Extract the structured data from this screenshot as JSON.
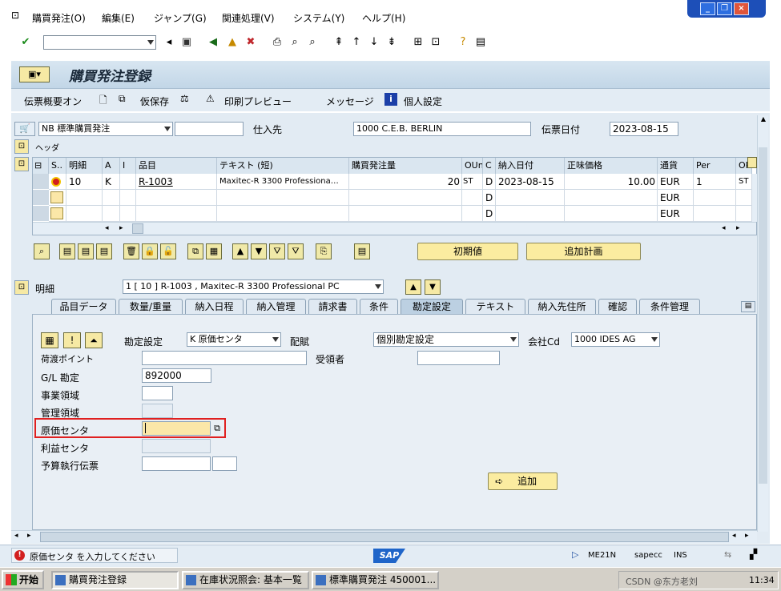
{
  "menu": [
    "購買発注(O)",
    "編集(E)",
    "ジャンプ(G)",
    "関連処理(V)",
    "システム(Y)",
    "ヘルプ(H)"
  ],
  "title": "購買発注登録",
  "app_toolbar": {
    "doc_overview": "伝票概要オン",
    "hold": "仮保存",
    "print_preview": "印刷プレビュー",
    "messages": "メッセージ",
    "personal_settings": "個人設定"
  },
  "header": {
    "doc_type": "NB 標準購買発注",
    "vendor_label": "仕入先",
    "vendor_value": "1000 C.E.B. BERLIN",
    "doc_date_label": "伝票日付",
    "doc_date_value": "2023-08-15",
    "header_label": "ヘッダ"
  },
  "table": {
    "columns": [
      "S..",
      "明細",
      "A",
      "I",
      "品目",
      "テキスト (短)",
      "購買発注量",
      "OUn",
      "C",
      "納入日付",
      "正味価格",
      "通貨",
      "Per",
      "OP"
    ],
    "rows": [
      {
        "item": "10",
        "a": "K",
        "material": "R-1003",
        "text": "Maxitec-R 3300 Professiona…",
        "qty": "20",
        "oun": "ST",
        "c": "D",
        "date": "2023-08-15",
        "price": "10.00",
        "curr": "EUR",
        "per": "1",
        "op": "ST"
      },
      {
        "c": "D",
        "curr": "EUR"
      },
      {
        "c": "D",
        "curr": "EUR"
      }
    ]
  },
  "buttons": {
    "default_values": "初期値",
    "add_planning": "追加計画",
    "add": "追加"
  },
  "detail": {
    "label": "明細",
    "selected": "1 [ 10 ] R-1003 , Maxitec-R 3300 Professional PC"
  },
  "tabs": [
    "品目データ",
    "数量/重量",
    "納入日程",
    "納入管理",
    "請求書",
    "条件",
    "勘定設定",
    "テキスト",
    "納入先住所",
    "確認",
    "条件管理"
  ],
  "active_tab": "勘定設定",
  "account": {
    "acc_label": "勘定設定",
    "acc_value": "K 原価センタ",
    "distribution_label": "配賦",
    "distribution_value": "個別勘定設定",
    "company_label": "会社Cd",
    "company_value": "1000 IDES AG",
    "unloading_label": "荷渡ポイント",
    "recipient_label": "受領者",
    "gl_label": "G/L 勘定",
    "gl_value": "892000",
    "business_area_label": "事業領域",
    "controlling_area_label": "管理領域",
    "cost_center_label": "原価センタ",
    "profit_center_label": "利益センタ",
    "funds_label": "予算執行伝票"
  },
  "status": {
    "message": "原価センタ を入力してください",
    "brand": "SAP",
    "tcode": "ME21N",
    "server": "sapecc",
    "mode": "INS"
  },
  "taskbar": {
    "start": "开始",
    "tasks": [
      "購買発注登録",
      "在庫状況照会: 基本一覧",
      "標準購買発注 450001..."
    ],
    "clock": "11:34",
    "watermark": "CSDN @东方老刘"
  },
  "colors": {
    "accent": "#1d4fb8",
    "highlight": "#e02020",
    "input_required": "#fbe7a8"
  }
}
